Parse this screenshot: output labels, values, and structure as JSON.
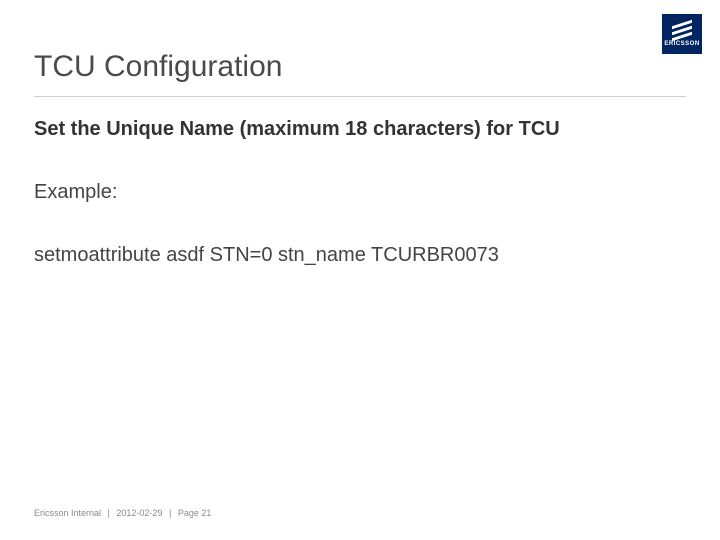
{
  "logo": {
    "brand_text": "ERICSSON"
  },
  "title": "TCU Configuration",
  "content": {
    "instruction": "Set the Unique Name (maximum 18 characters) for TCU",
    "example_label": "Example:",
    "example_command": "setmoattribute asdf STN=0 stn_name TCURBR0073"
  },
  "footer": {
    "classification": "Ericsson Internal",
    "date": "2012-02-29",
    "page_prefix": "Page ",
    "page_number": "21"
  }
}
